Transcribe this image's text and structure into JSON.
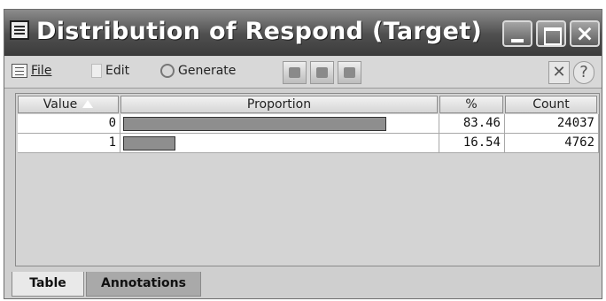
{
  "window": {
    "title": "Distribution of Respond (Target)",
    "controls": [
      "minimize-icon",
      "maximize-icon",
      "close-icon"
    ]
  },
  "toolbar": {
    "menus": [
      {
        "label": "File",
        "icon": "file-icon"
      },
      {
        "label": "Edit",
        "icon": "edit-icon"
      },
      {
        "label": "Generate",
        "icon": "generate-icon"
      }
    ],
    "buttons": [
      "table-icon",
      "print-icon",
      "export-icon"
    ],
    "close_symbol": "✕",
    "help_symbol": "?"
  },
  "table": {
    "columns": [
      "Value",
      "Proportion",
      "%",
      "Count"
    ],
    "sort_column": "Value",
    "rows": [
      {
        "value": "0",
        "proportion": 0.8346,
        "percent": "83.46",
        "count": "24037"
      },
      {
        "value": "1",
        "proportion": 0.1654,
        "percent": "16.54",
        "count": "4762"
      }
    ],
    "bar_color": "#8e8e8e"
  },
  "tabs": [
    {
      "label": "Table",
      "active": true
    },
    {
      "label": "Annotations",
      "active": false
    }
  ]
}
